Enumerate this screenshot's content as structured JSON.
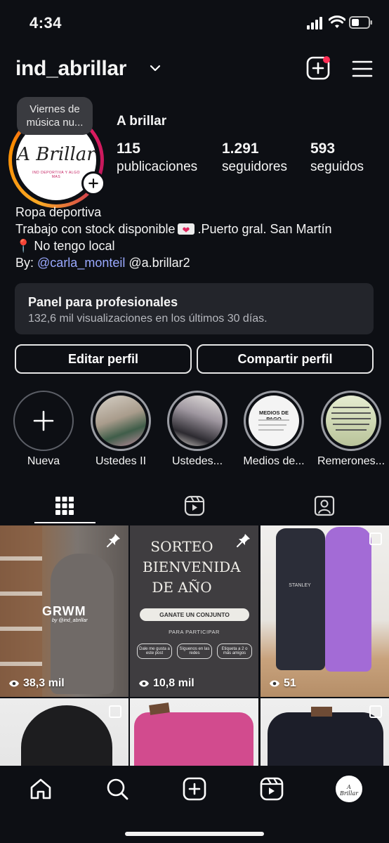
{
  "status_bar": {
    "time": "4:34"
  },
  "header": {
    "username": "ind_abrillar"
  },
  "profile": {
    "avatar_text": "A Brillar",
    "avatar_subtext": "IND DEPORTIVA Y ALGO MAS",
    "note": "Viernes de música nu...",
    "display_name": "A brillar",
    "stats": [
      {
        "value": "115",
        "label": "publicaciones"
      },
      {
        "value": "1.291",
        "label": "seguidores"
      },
      {
        "value": "593",
        "label": "seguidos"
      }
    ],
    "bio": {
      "line1": "Ropa deportiva",
      "line2_start": "Trabajo con stock disponible",
      "line2_end": ".Puerto gral. San Martín",
      "line3": "No tengo local",
      "line4_prefix": "By:",
      "mention1": "@carla_monteil",
      "mention2": "@a.brillar2"
    }
  },
  "pro_panel": {
    "title": "Panel para profesionales",
    "subtitle": "132,6 mil visualizaciones en los últimos 30 días."
  },
  "buttons": {
    "edit": "Editar perfil",
    "share": "Compartir perfil"
  },
  "highlights": [
    {
      "label": "Nueva"
    },
    {
      "label": "Ustedes II"
    },
    {
      "label": "Ustedes..."
    },
    {
      "label": "Medios de..."
    },
    {
      "label": "Remerones..."
    }
  ],
  "highlight_thumbs": {
    "medios": "MEDIOS DE PAGO"
  },
  "posts": [
    {
      "views": "38,3 mil",
      "caption": "GRWM",
      "caption_sub": "by @ind_abrillar",
      "pinned": true
    },
    {
      "views": "10,8 mil",
      "pinned": true,
      "title": "SORTEO BIENVENIDA DE AÑO",
      "pill": "GANATE UN CONJUNTO",
      "participate": "PARA PARTICIPAR",
      "steps": [
        "Dale me gusta a este post",
        "Síguenos en las redes",
        "Etiqueta a 2 o más amigos"
      ]
    },
    {
      "views": "51",
      "multi": true,
      "brand": "STANLEY"
    },
    {
      "multi": true
    },
    {
      "multi": false
    },
    {
      "multi": true
    }
  ],
  "colors": {
    "background": "#0d0f14",
    "panel": "#23252b",
    "mention": "#9aa9ff",
    "notification": "#ff2d55"
  }
}
